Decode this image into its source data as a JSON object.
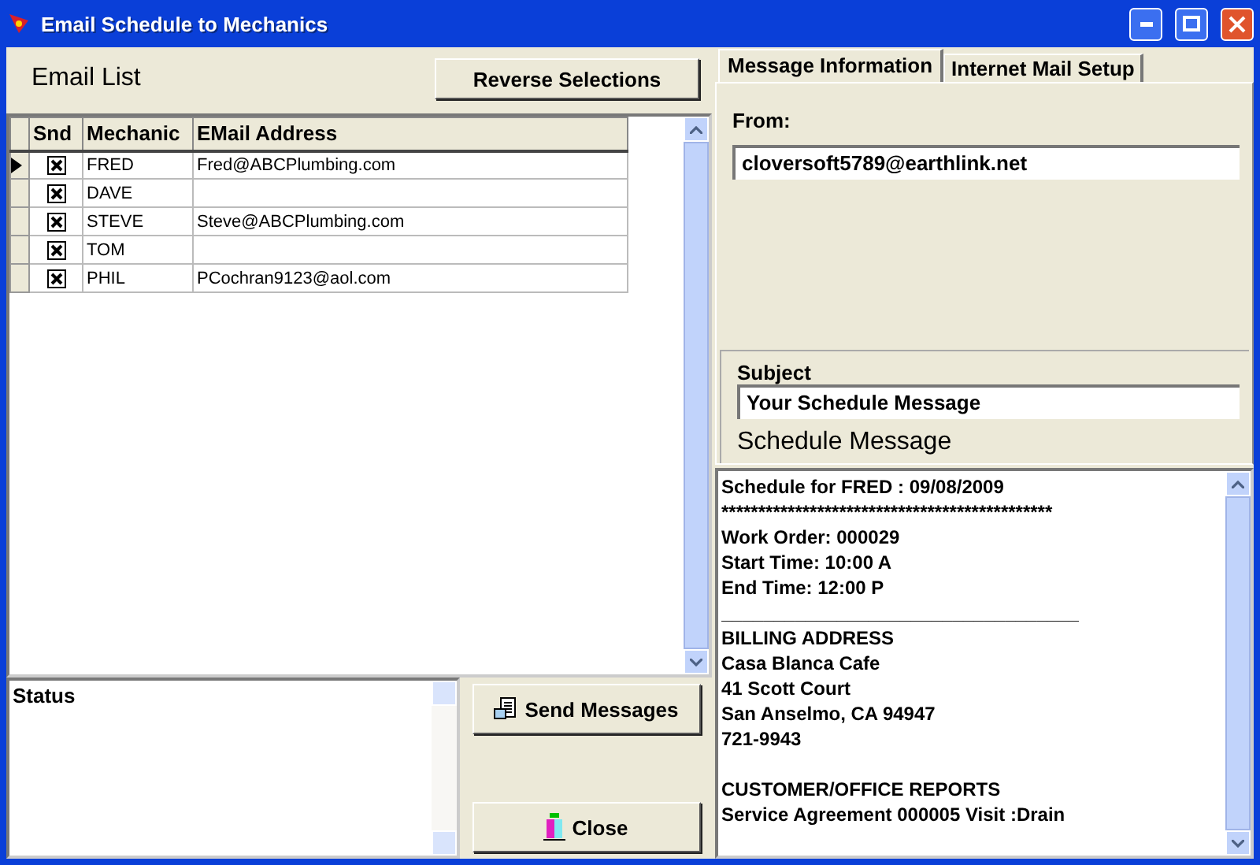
{
  "window": {
    "title": "Email Schedule to Mechanics"
  },
  "email_list": {
    "title": "Email List",
    "reverse_button": "Reverse Selections",
    "columns": [
      "Snd",
      "Mechanic",
      "EMail Address"
    ],
    "rows": [
      {
        "selected": true,
        "checked": true,
        "mechanic": "FRED",
        "email": "Fred@ABCPlumbing.com"
      },
      {
        "selected": false,
        "checked": true,
        "mechanic": "DAVE"
      },
      {
        "selected": false,
        "checked": true,
        "mechanic": "STEVE",
        "email": "Steve@ABCPlumbing.com"
      },
      {
        "selected": false,
        "checked": true,
        "mechanic": "TOM"
      },
      {
        "selected": false,
        "checked": true,
        "mechanic": "PHIL",
        "email": "PCochran9123@aol.com"
      }
    ]
  },
  "status": {
    "label": "Status"
  },
  "buttons": {
    "send": "Send Messages",
    "close": "Close"
  },
  "tabs": [
    {
      "label": "Message Information",
      "selected": true
    },
    {
      "label": "Internet Mail Setup",
      "selected": false
    }
  ],
  "from": {
    "label": "From:",
    "value": "cloversoft5789@earthlink.net"
  },
  "subject": {
    "label": "Subject",
    "value": "Your Schedule Message"
  },
  "message": {
    "title": "Schedule Message",
    "paragraphs": [
      [
        "Schedule for FRED : 09/08/2009",
        "*********************************************",
        "Work Order: 000029",
        "Start Time: 10:00 A",
        "End Time: 12:00 P",
        "__________________________________",
        "BILLING ADDRESS",
        "Casa Blanca Cafe",
        "41 Scott Court",
        "San Anselmo, CA 94947",
        "721-9943"
      ],
      [
        "CUSTOMER/OFFICE REPORTS",
        "Service Agreement 000005 Visit :Drain"
      ]
    ]
  }
}
